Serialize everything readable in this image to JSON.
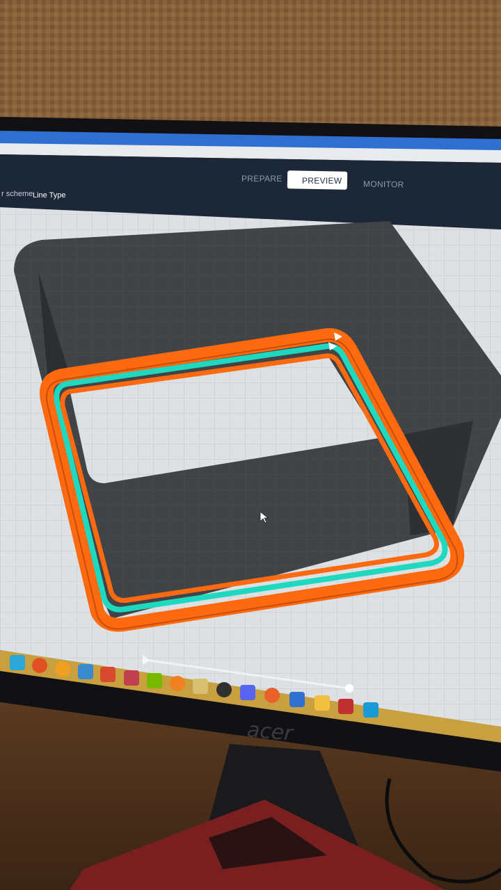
{
  "header": {
    "tabs": [
      {
        "label": "PREPARE",
        "active": false
      },
      {
        "label": "PREVIEW",
        "active": true
      },
      {
        "label": "MONITOR",
        "active": false
      }
    ]
  },
  "toolbar": {
    "color_scheme_label": "r scheme",
    "color_scheme_value": "Line Type"
  },
  "monitor_brand": "acer",
  "colors": {
    "outer_wall": "#ff6a10",
    "inner_wall": "#1fd8c0",
    "build_plate": "#d9dde0",
    "shadow": "#3a3c3f",
    "toolbar_bg": "#1c2738",
    "taskbar": "#c8a040"
  },
  "taskbar_icons": [
    "blender-icon",
    "opencl-icon",
    "chrome-icon",
    "nav-icon",
    "photo-icon",
    "cube-icon",
    "nvidia-icon",
    "web-icon",
    "inkscape-icon",
    "obs-icon",
    "discord-icon",
    "firefox-icon",
    "file-explorer-icon",
    "folder-icon",
    "grid-icon",
    "cura-icon"
  ]
}
